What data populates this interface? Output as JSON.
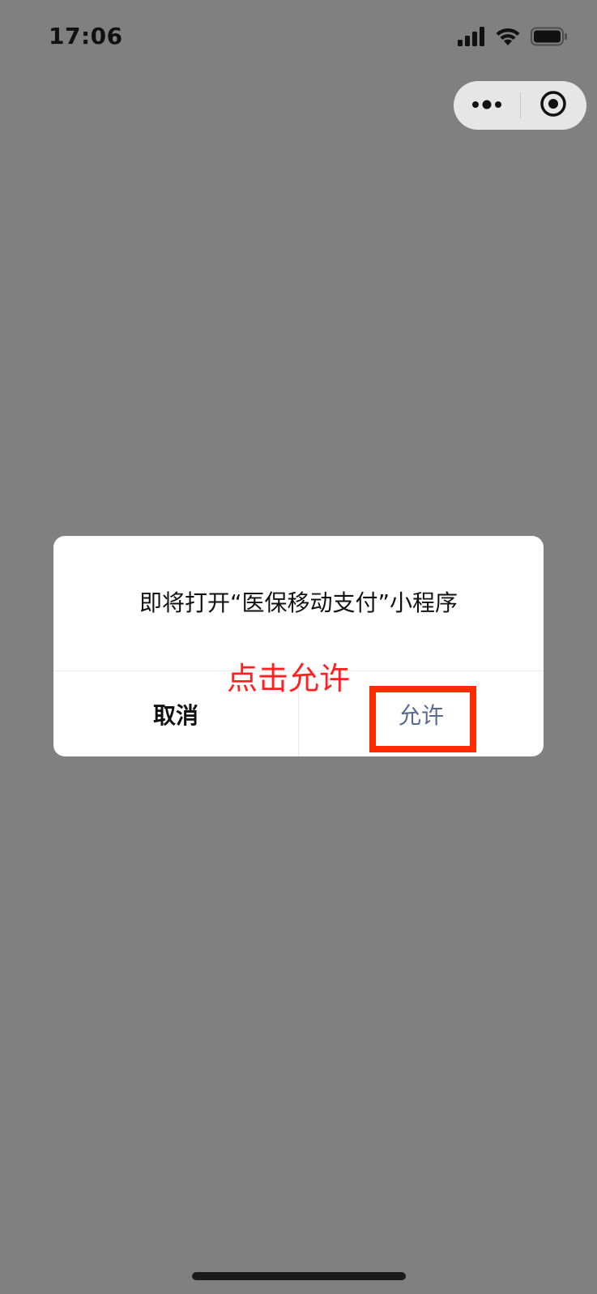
{
  "status_bar": {
    "time": "17:06",
    "icons": [
      "signal-icon",
      "wifi-icon",
      "battery-icon"
    ]
  },
  "capsule": {
    "more_icon": "more-dots-icon",
    "close_icon": "target-circle-icon"
  },
  "dialog": {
    "message": "即将打开“医保移动支付”小程序",
    "cancel_label": "取消",
    "allow_label": "允许"
  },
  "annotation": {
    "text": "点击允许",
    "color": "#ff2a00"
  },
  "colors": {
    "overlay": "#808080",
    "dialog_bg": "#ffffff",
    "allow_text": "#576b95",
    "cancel_text": "#111111"
  }
}
